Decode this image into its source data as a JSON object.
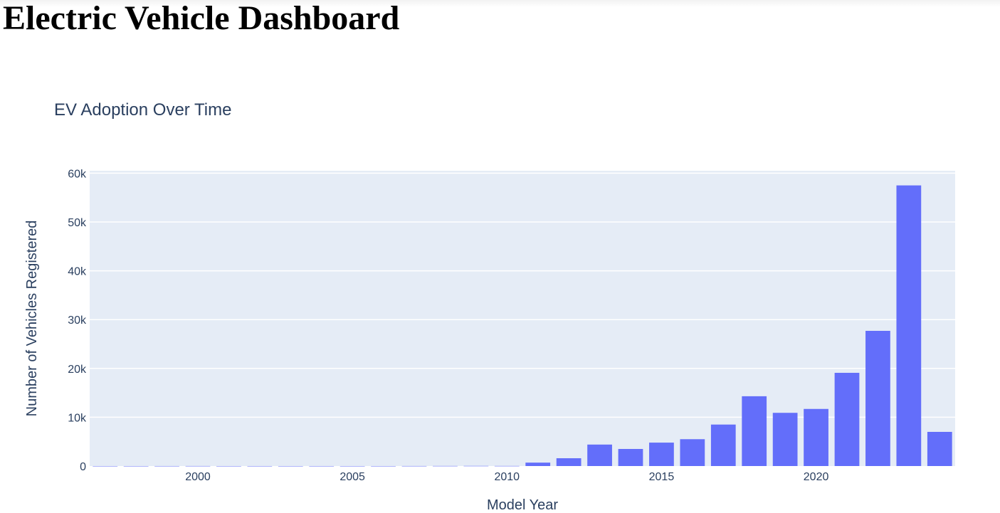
{
  "page": {
    "heading": "Electric Vehicle Dashboard"
  },
  "colors": {
    "plot_background": "#e5ecf6",
    "bar": "#636efa",
    "text": "#2a3f5f",
    "grid": "#ffffff"
  },
  "chart_data": {
    "type": "bar",
    "title": "EV Adoption Over Time",
    "xlabel": "Model Year",
    "ylabel": "Number of Vehicles Registered",
    "x": [
      1997,
      1998,
      1999,
      2000,
      2001,
      2002,
      2003,
      2004,
      2005,
      2006,
      2007,
      2008,
      2009,
      2010,
      2011,
      2012,
      2013,
      2014,
      2015,
      2016,
      2017,
      2018,
      2019,
      2020,
      2021,
      2022,
      2023,
      2024
    ],
    "values": [
      1,
      1,
      5,
      10,
      1,
      2,
      1,
      2,
      1,
      1,
      10,
      20,
      30,
      20,
      700,
      1600,
      4400,
      3500,
      4800,
      5500,
      8500,
      14300,
      10900,
      11700,
      19100,
      27700,
      57500,
      7000
    ],
    "xlim": [
      1996.5,
      2024.5
    ],
    "ylim": [
      0,
      60500
    ],
    "x_ticks": [
      2000,
      2005,
      2010,
      2015,
      2020
    ],
    "x_tick_labels": [
      "2000",
      "2005",
      "2010",
      "2015",
      "2020"
    ],
    "y_ticks": [
      0,
      10000,
      20000,
      30000,
      40000,
      50000,
      60000
    ],
    "y_tick_labels": [
      "0",
      "10k",
      "20k",
      "30k",
      "40k",
      "50k",
      "60k"
    ],
    "grid": true,
    "legend": "none"
  }
}
